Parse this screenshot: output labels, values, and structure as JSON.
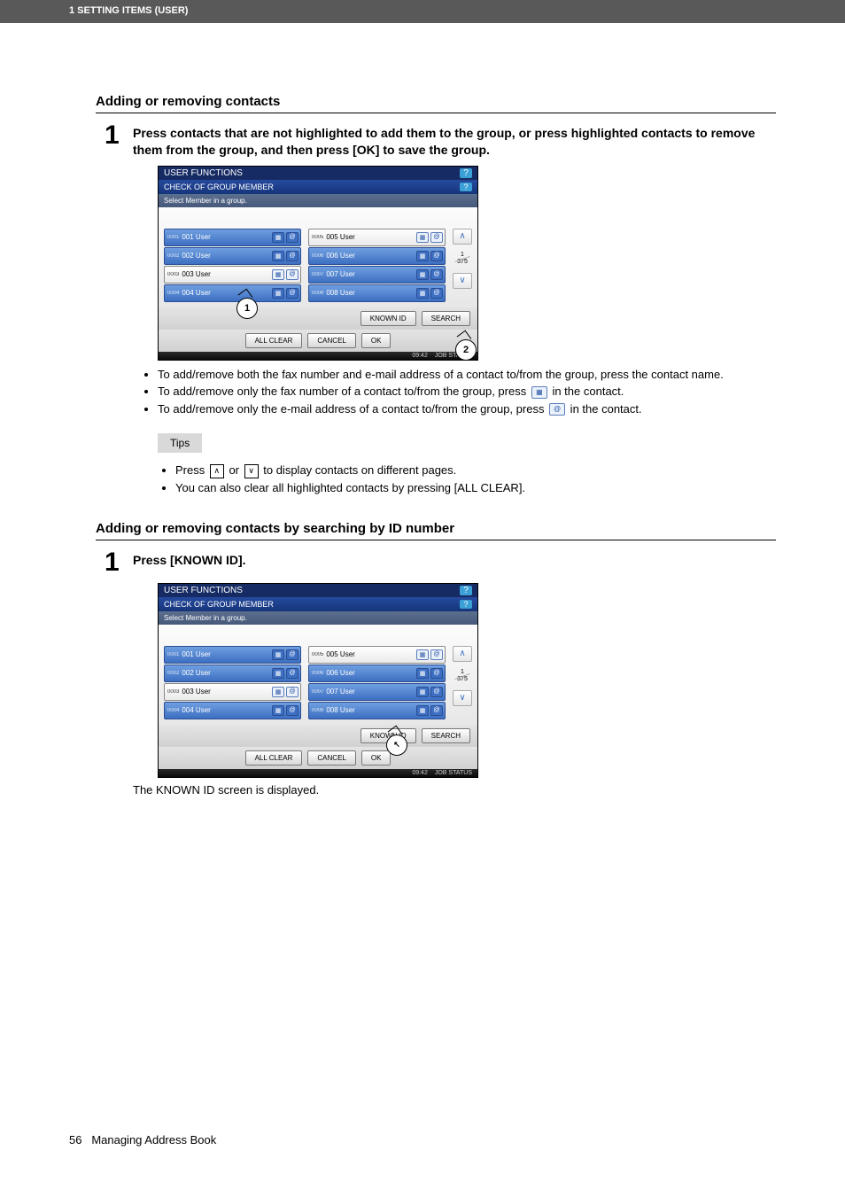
{
  "banner": "1 SETTING ITEMS (USER)",
  "section1_title": "Adding or removing contacts",
  "step1_num": "1",
  "step1_text": "Press contacts that are not highlighted to add them to the group, or press highlighted contacts to remove them from the group, and then press [OK] to save the group.",
  "panel": {
    "headbar": "USER FUNCTIONS",
    "subbar": "CHECK OF GROUP MEMBER",
    "instr": "Select Member in a group.",
    "q": "?",
    "contacts_left": [
      {
        "id": "0001",
        "name": "001 User",
        "sel": true
      },
      {
        "id": "0002",
        "name": "002 User",
        "sel": true
      },
      {
        "id": "0003",
        "name": "003 User",
        "sel": false
      },
      {
        "id": "0004",
        "name": "004 User",
        "sel": true
      }
    ],
    "contacts_right": [
      {
        "id": "0005",
        "name": "005 User",
        "sel": false
      },
      {
        "id": "0006",
        "name": "006 User",
        "sel": true
      },
      {
        "id": "0007",
        "name": "007 User",
        "sel": true
      },
      {
        "id": "0008",
        "name": "008 User",
        "sel": true
      }
    ],
    "page_current": "1",
    "page_total": "375",
    "known_id": "KNOWN ID",
    "search": "SEARCH",
    "all_clear": "ALL CLEAR",
    "cancel": "CANCEL",
    "ok": "OK",
    "time": "09:42",
    "jobstatus": "JOB STATUS"
  },
  "callout1": "1",
  "callout2": "2",
  "bullets1": {
    "b1": "To add/remove both the fax number and e-mail address of a contact to/from the group, press the contact name.",
    "b2a": "To add/remove only the fax number of a contact to/from the group, press ",
    "b2b": " in the contact.",
    "b3a": "To add/remove only the e-mail address of a contact to/from the group, press ",
    "b3b": " in the contact."
  },
  "tips_label": "Tips",
  "tips": {
    "t1a": "Press ",
    "t1b": " or ",
    "t1c": " to display contacts on different pages.",
    "t2": "You can also clear all highlighted contacts by pressing [ALL CLEAR]."
  },
  "section2_title": "Adding or removing contacts by searching by ID number",
  "step2_num": "1",
  "step2_text": "Press [KNOWN ID].",
  "after_panel2": "The KNOWN ID screen is displayed.",
  "footer_page": "56",
  "footer_text": "Managing Address Book",
  "icons": {
    "fax_glyph": "▦",
    "mail_glyph": "@",
    "up": "∧",
    "down": "∨"
  }
}
